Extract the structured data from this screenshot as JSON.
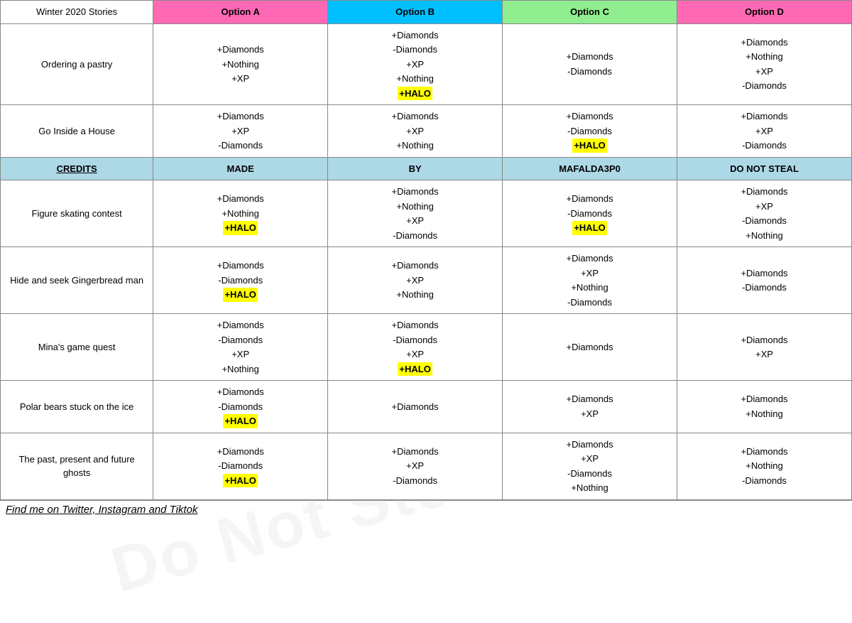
{
  "header": {
    "col0": "Winter 2020 Stories",
    "colA": "Option A",
    "colB": "Option B",
    "colC": "Option C",
    "colD": "Option D"
  },
  "rows": [
    {
      "story": "Ordering a pastry",
      "a": [
        "+Diamonds",
        "+Nothing",
        "+XP"
      ],
      "b": [
        "+Diamonds",
        "-Diamonds",
        "+XP",
        "+Nothing",
        "+HALO"
      ],
      "c": [
        "+Diamonds",
        "-Diamonds"
      ],
      "d": [
        "+Diamonds",
        "+Nothing",
        "+XP",
        "-Diamonds"
      ]
    },
    {
      "story": "Go Inside a House",
      "a": [
        "+Diamonds",
        "+XP",
        "-Diamonds"
      ],
      "b": [
        "+Diamonds",
        "+XP",
        "+Nothing"
      ],
      "c": [
        "+Diamonds",
        "-Diamonds",
        "+HALO"
      ],
      "d": [
        "+Diamonds",
        "+XP",
        "-Diamonds"
      ]
    },
    {
      "credits": true,
      "col0": "CREDITS",
      "colA": "MADE",
      "colB": "BY",
      "colC": "MAFALDA3P0",
      "colD": "DO NOT STEAL"
    },
    {
      "story": "Figure skating contest",
      "a": [
        "+Diamonds",
        "+Nothing",
        "+HALO"
      ],
      "b": [
        "+Diamonds",
        "+Nothing",
        "+XP",
        "-Diamonds"
      ],
      "c": [
        "+Diamonds",
        "-Diamonds",
        "+HALO"
      ],
      "d": [
        "+Diamonds",
        "+XP",
        "-Diamonds",
        "+Nothing"
      ]
    },
    {
      "story": "Hide and seek Gingerbread man",
      "a": [
        "+Diamonds",
        "-Diamonds",
        "+HALO"
      ],
      "b": [
        "+Diamonds",
        "+XP",
        "+Nothing"
      ],
      "c": [
        "+Diamonds",
        "+XP",
        "+Nothing",
        "-Diamonds"
      ],
      "d": [
        "+Diamonds",
        "-Diamonds"
      ]
    },
    {
      "story": "Mina's game quest",
      "a": [
        "+Diamonds",
        "-Diamonds",
        "+XP",
        "+Nothing"
      ],
      "b": [
        "+Diamonds",
        "-Diamonds",
        "+XP",
        "+HALO"
      ],
      "c": [
        "+Diamonds"
      ],
      "d": [
        "+Diamonds",
        "+XP"
      ]
    },
    {
      "story": "Polar bears stuck on the ice",
      "a": [
        "+Diamonds",
        "-Diamonds",
        "+HALO"
      ],
      "b": [
        "+Diamonds"
      ],
      "c": [
        "+Diamonds",
        "+XP"
      ],
      "d": [
        "+Diamonds",
        "+Nothing"
      ]
    },
    {
      "story": "The past, present and future ghosts",
      "a": [
        "+Diamonds",
        "-Diamonds",
        "+HALO"
      ],
      "b": [
        "+Diamonds",
        "+XP",
        "-Diamonds"
      ],
      "c": [
        "+Diamonds",
        "+XP",
        "-Diamonds",
        "+Nothing"
      ],
      "d": [
        "+Diamonds",
        "+Nothing",
        "-Diamonds"
      ]
    }
  ],
  "footer": "Find me on Twitter, Instagram and Tiktok",
  "watermarks": {
    "made_by": "MADE BY",
    "mafalda": "MAFALDA3P0",
    "do_not_steal": "Do Not Steal"
  }
}
